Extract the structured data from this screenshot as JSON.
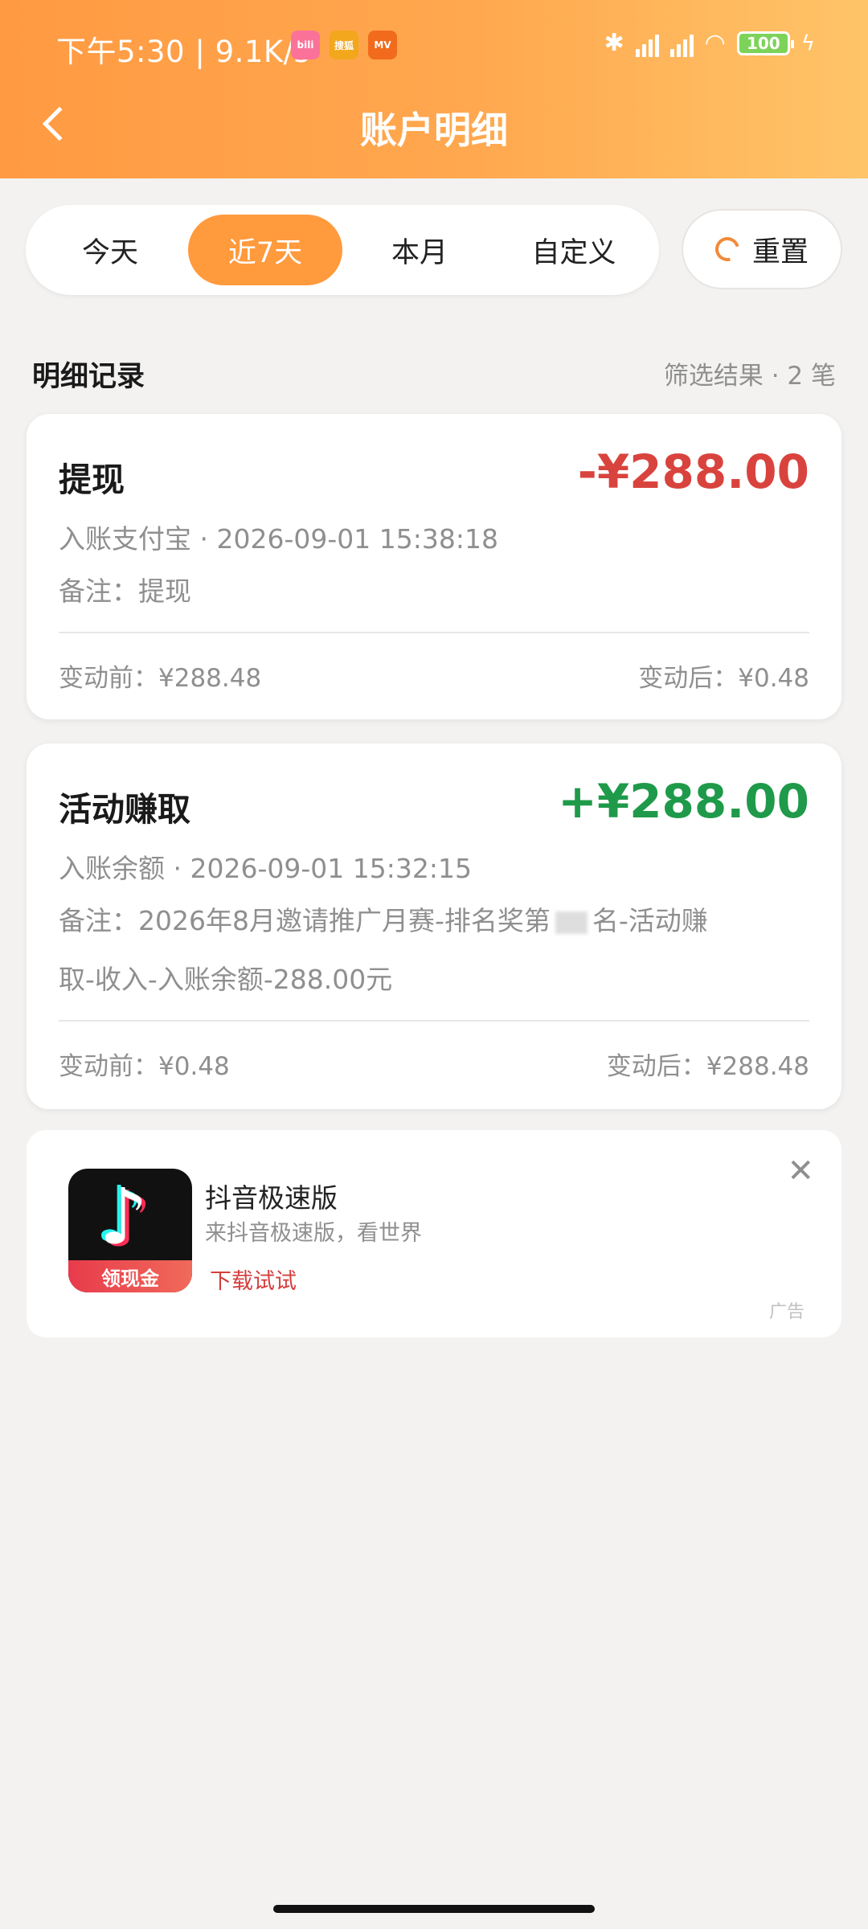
{
  "status_bar": {
    "time": "下午5:30 | 9.1K/s",
    "apps": [
      {
        "icon": "bilibili-app-icon",
        "label": "bili",
        "color": "#fb7299"
      },
      {
        "icon": "sohu-app-icon",
        "label": "搜狐",
        "color": "#f2a71c"
      },
      {
        "icon": "mgtv-app-icon",
        "label": "MV",
        "color": "#f26a1b"
      }
    ],
    "battery": "100"
  },
  "header": {
    "title": "账户明细",
    "back_icon": "chevron-left-icon"
  },
  "filters": {
    "tabs": [
      "今天",
      "近7天",
      "本月",
      "自定义"
    ],
    "active_index": 1,
    "reset_label": "重置",
    "accent_color": "#ff9a3d"
  },
  "section": {
    "title": "明细记录",
    "count_text": "筛选结果 · 2 笔"
  },
  "records": [
    {
      "title": "提现",
      "amount": "-¥288.00",
      "meta": "入账支付宝 · 2026-09-01 15:38:18",
      "note": "备注：提现",
      "before": "变动前：¥288.48",
      "after": "变动后：¥0.48"
    },
    {
      "title": "活动赚取",
      "amount": "+¥288.00",
      "meta": "入账余额 · 2026-09-01 15:32:15",
      "note_part1": "备注：2026年8月邀请推广月赛-排名奖第",
      "note_part2": "名-活动赚",
      "note_line2": "取-收入-入账余额-288.00元",
      "before": "变动前：¥0.48",
      "after": "变动后：¥288.48"
    }
  ],
  "ad": {
    "title": "抖音极速版",
    "desc": "来抖音极速版，看世界",
    "cta": "下载试试",
    "logo_badge": "领现金",
    "tag": "广告",
    "close_icon": "close-icon"
  }
}
